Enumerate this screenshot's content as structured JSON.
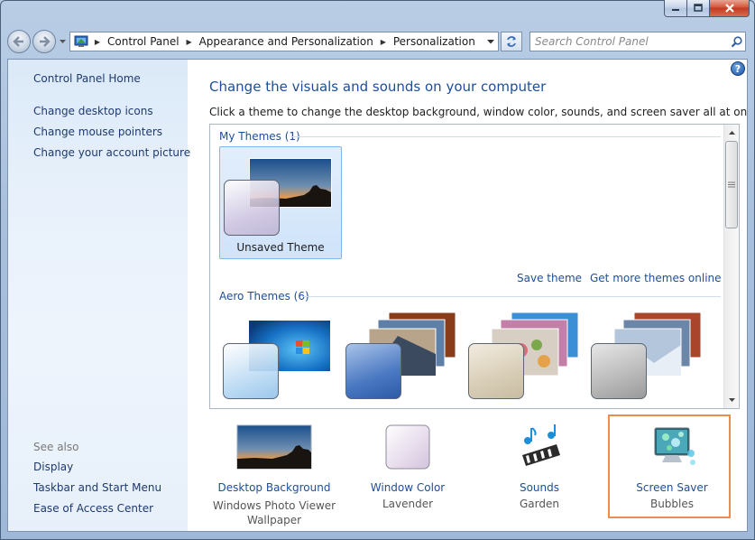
{
  "window": {
    "controls": [
      "minimize",
      "maximize",
      "close"
    ]
  },
  "nav": {
    "back_icon": "back-arrow-icon",
    "forward_icon": "forward-arrow-icon"
  },
  "address": {
    "breadcrumbs": [
      "Control Panel",
      "Appearance and Personalization",
      "Personalization"
    ]
  },
  "search": {
    "placeholder": "Search Control Panel"
  },
  "sidebar": {
    "home": "Control Panel Home",
    "links": [
      "Change desktop icons",
      "Change mouse pointers",
      "Change your account picture"
    ],
    "see_also_label": "See also",
    "see_also": [
      "Display",
      "Taskbar and Start Menu",
      "Ease of Access Center"
    ]
  },
  "main": {
    "title": "Change the visuals and sounds on your computer",
    "description": "Click a theme to change the desktop background, window color, sounds, and screen saver all at once."
  },
  "themes": {
    "my_themes_label": "My Themes (1)",
    "my_themes": [
      {
        "name": "Unsaved Theme",
        "selected": true
      }
    ],
    "save_theme": "Save theme",
    "get_more": "Get more themes online",
    "aero_label": "Aero Themes (6)",
    "aero_count_visible": 4
  },
  "bottom": {
    "desktop_background": {
      "title": "Desktop Background",
      "sub": "Windows Photo Viewer Wallpaper"
    },
    "window_color": {
      "title": "Window Color",
      "sub": "Lavender"
    },
    "sounds": {
      "title": "Sounds",
      "sub": "Garden"
    },
    "screen_saver": {
      "title": "Screen Saver",
      "sub": "Bubbles"
    }
  },
  "colors": {
    "link": "#1e4e99",
    "highlight": "#ec8d50",
    "selection": "#cfe3fa"
  }
}
